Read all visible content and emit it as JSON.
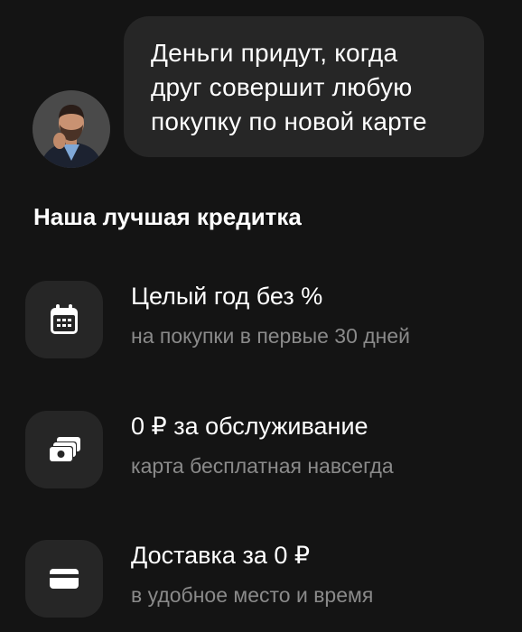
{
  "message": {
    "lines": [
      "Деньги придут, когда",
      "друг совершит любую",
      "покупку по новой карте"
    ]
  },
  "section": {
    "title": "Наша лучшая кредитка"
  },
  "features": [
    {
      "icon": "calendar-icon",
      "title": "Целый год без %",
      "subtitle": "на покупки в первые 30 дней"
    },
    {
      "icon": "banknotes-icon",
      "title": "0 ₽ за обслуживание",
      "subtitle": "карта бесплатная навсегда"
    },
    {
      "icon": "credit-card-icon",
      "title": "Доставка за 0 ₽",
      "subtitle": "в удобное место и время"
    }
  ],
  "colors": {
    "background": "#141414",
    "surface": "#262626",
    "text_primary": "#ffffff",
    "text_secondary": "#8a8a8a"
  }
}
